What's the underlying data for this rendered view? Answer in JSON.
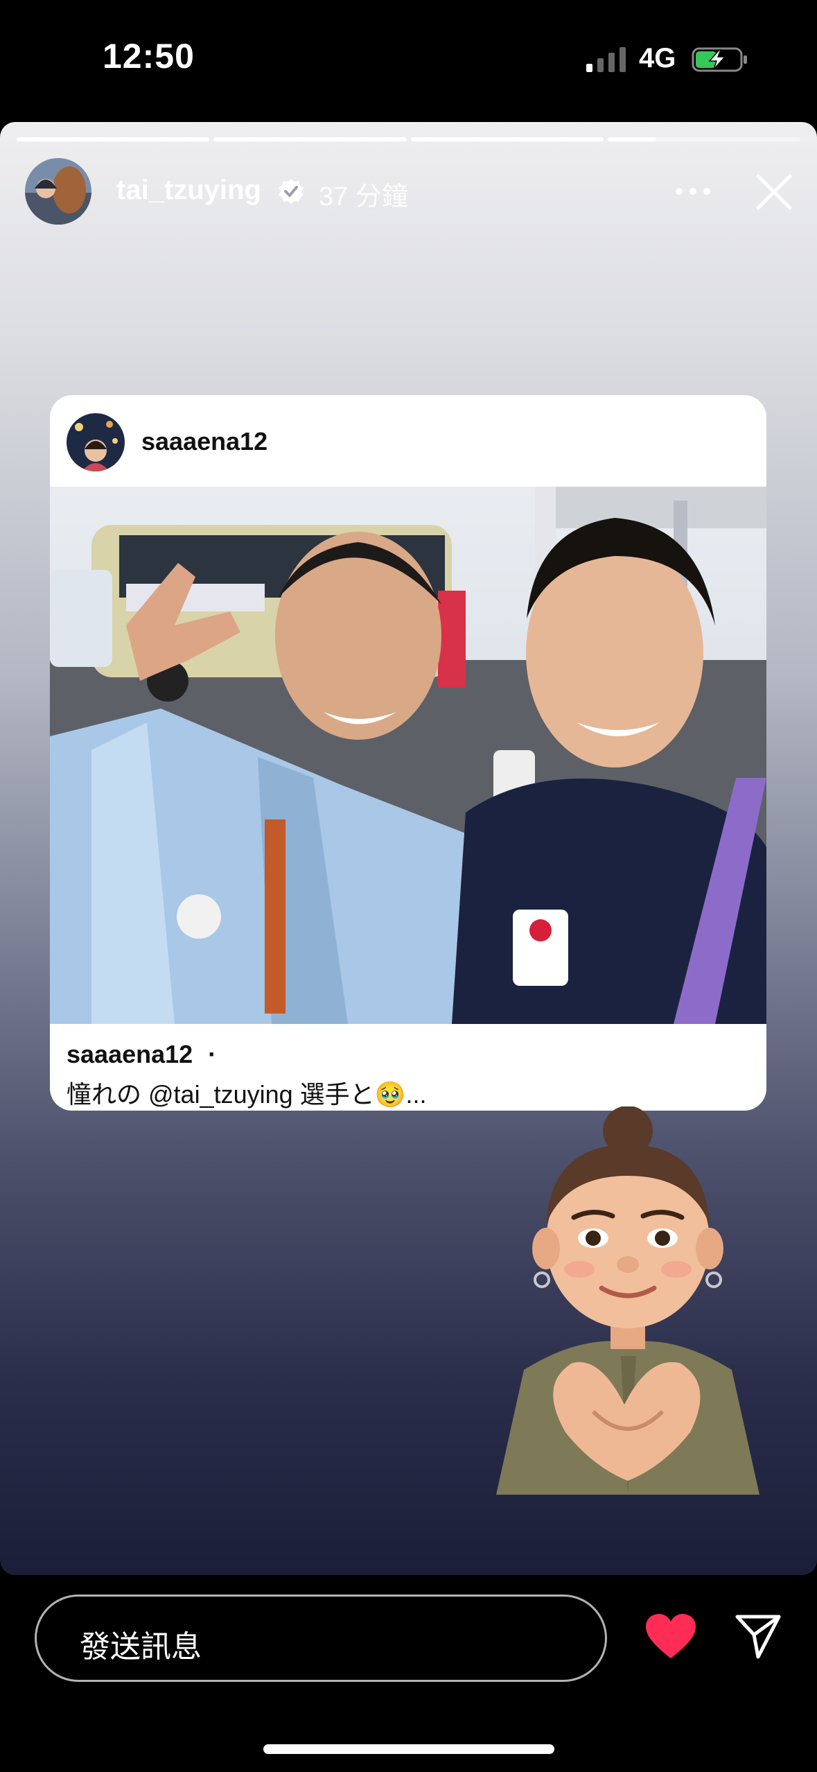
{
  "status_bar": {
    "time": "12:50",
    "network": "4G",
    "signal_bars_active": 1
  },
  "story": {
    "progress": [
      1,
      1,
      1,
      0.25
    ],
    "username": "tai_tzuying",
    "time_ago": "37 分鐘",
    "icons": {
      "verified": "verified-badge-icon",
      "more": "more-horizontal-icon",
      "close": "close-icon"
    }
  },
  "shared_post": {
    "username": "saaaena12",
    "caption_user": "saaaena12",
    "caption_dot": "·",
    "caption_text": "憧れの @tai_tzuying 選手と🥹..."
  },
  "bottom_bar": {
    "message_placeholder": "發送訊息",
    "heart_color": "#ff2d55"
  }
}
